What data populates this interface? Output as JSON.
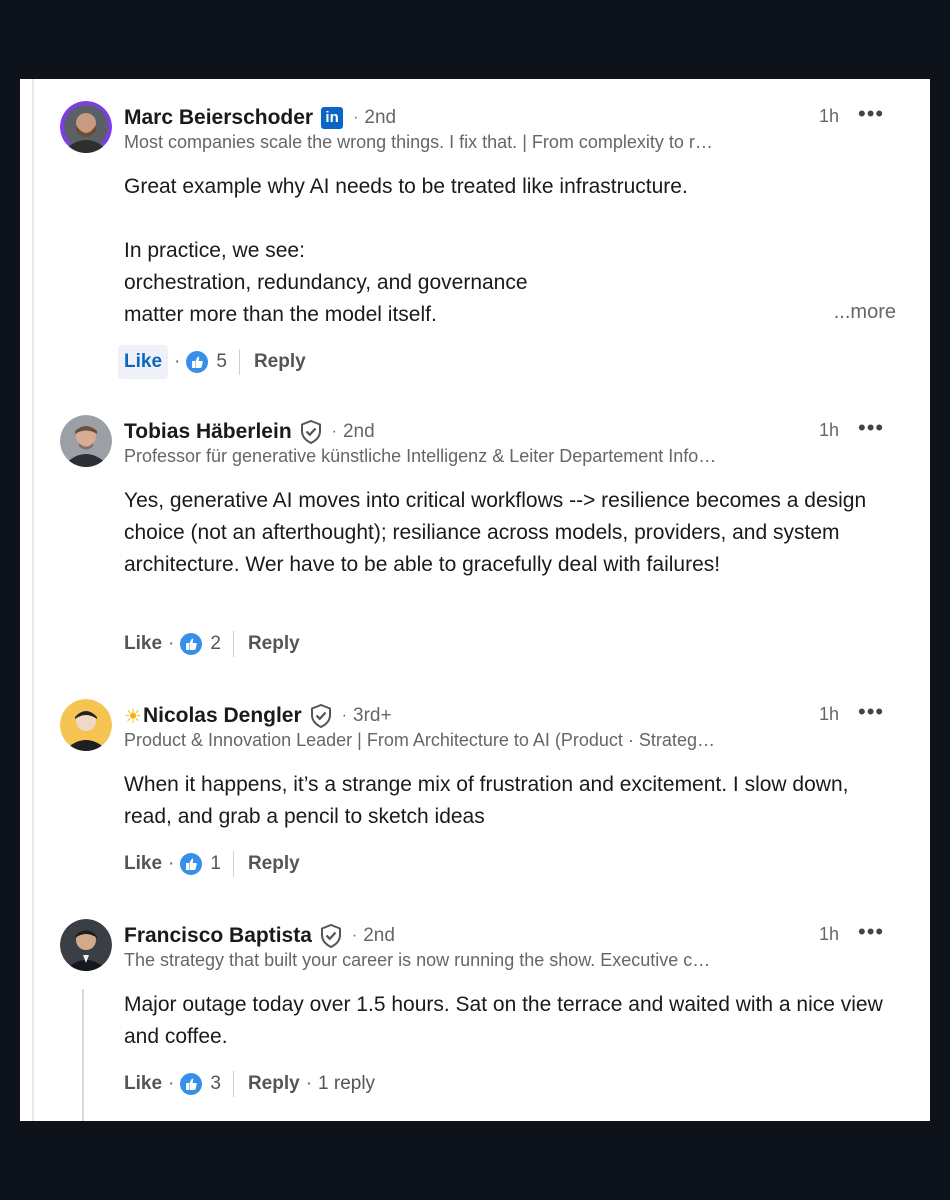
{
  "comments": [
    {
      "name": "Marc Beierschoder",
      "degree": "2nd",
      "headline": "Most companies scale the wrong things. I fix that. | From complexity to r…",
      "time": "1h",
      "menu": "•••",
      "body": [
        "Great example why AI needs to be treated like infrastructure.",
        "",
        "In practice, we see:",
        "orchestration, redundancy, and governance",
        "matter more than the model itself."
      ],
      "see_more": "...more",
      "like_label": "Like",
      "reaction_count": "5",
      "reply_label": "Reply",
      "badge": "in"
    },
    {
      "name": "Tobias Häberlein",
      "degree": "2nd",
      "headline": "Professor für generative künstliche Intelligenz & Leiter Departement Info…",
      "time": "1h",
      "menu": "•••",
      "body_text": "Yes, generative AI moves into critical workflows --> resilience becomes a design choice (not an afterthought); resiliance across models, providers, and system architecture. Wer have to be able to gracefully deal with failures!",
      "like_label": "Like",
      "reaction_count": "2",
      "reply_label": "Reply"
    },
    {
      "prefix_icon": "☀",
      "name": "Nicolas Dengler",
      "degree": "3rd+",
      "headline": "Product & Innovation Leader | From Architecture to AI (Product · Strateg…",
      "time": "1h",
      "menu": "•••",
      "body_text": "When it happens, it’s a strange mix of frustration and excitement. I slow down, read, and grab a pencil to sketch ideas",
      "like_label": "Like",
      "reaction_count": "1",
      "reply_label": "Reply"
    },
    {
      "name": "Francisco Baptista",
      "degree": "2nd",
      "headline": "The strategy that built your career is now running the show. Executive c…",
      "time": "1h",
      "menu": "•••",
      "body_text": "Major outage today over 1.5 hours. Sat on the terrace and waited with a nice view and coffee.",
      "like_label": "Like",
      "reaction_count": "3",
      "reply_label": "Reply",
      "reply_count": "1 reply"
    }
  ],
  "separator": "·",
  "colors": {
    "accent": "#0a66c2",
    "text": "#1a1a1a",
    "muted": "#666666",
    "background": "#0e121b"
  }
}
